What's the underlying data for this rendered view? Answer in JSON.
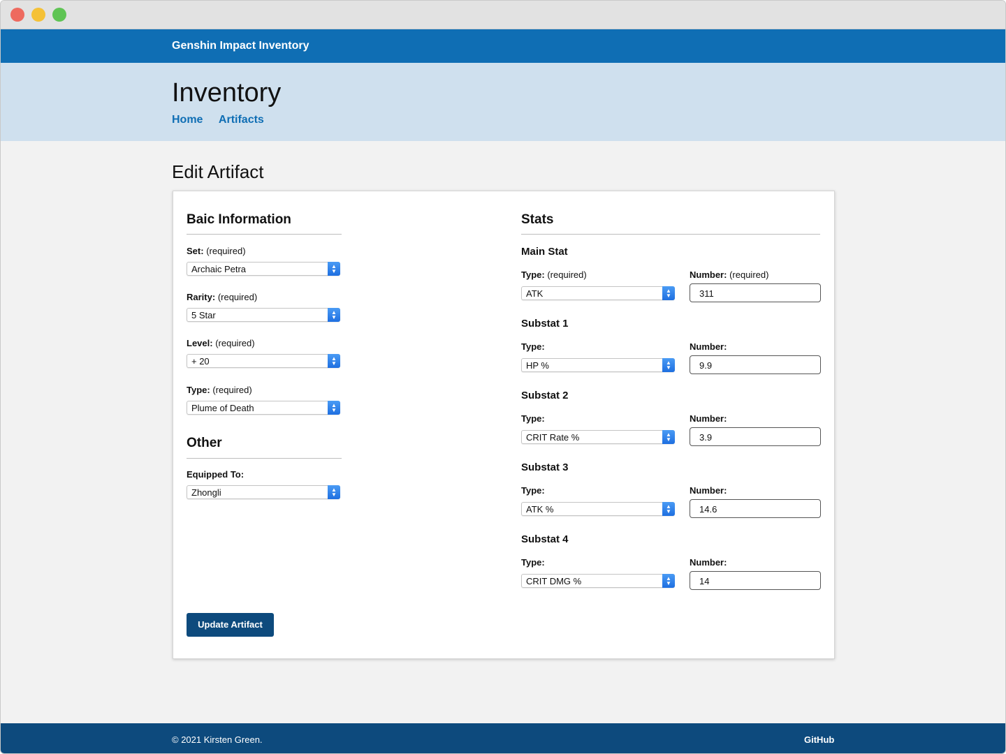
{
  "nav": {
    "brand": "Genshin Impact Inventory"
  },
  "hero": {
    "title": "Inventory",
    "links": [
      "Home",
      "Artifacts"
    ]
  },
  "page": {
    "heading": "Edit Artifact"
  },
  "basic": {
    "title": "Baic Information",
    "set": {
      "label": "Set:",
      "hint": "(required)",
      "value": "Archaic Petra"
    },
    "rarity": {
      "label": "Rarity:",
      "hint": "(required)",
      "value": "5 Star"
    },
    "level": {
      "label": "Level:",
      "hint": "(required)",
      "value": "+ 20"
    },
    "type": {
      "label": "Type:",
      "hint": "(required)",
      "value": "Plume of Death"
    }
  },
  "other": {
    "title": "Other",
    "equipped": {
      "label": "Equipped To:",
      "value": "Zhongli"
    }
  },
  "stats": {
    "title": "Stats",
    "main": {
      "title": "Main Stat",
      "type_label": "Type:",
      "type_hint": "(required)",
      "type_value": "ATK",
      "number_label": "Number:",
      "number_hint": "(required)",
      "number_value": "311"
    },
    "subs": [
      {
        "title": "Substat 1",
        "type_label": "Type:",
        "type_value": "HP %",
        "number_label": "Number:",
        "number_value": "9.9"
      },
      {
        "title": "Substat 2",
        "type_label": "Type:",
        "type_value": "CRIT Rate %",
        "number_label": "Number:",
        "number_value": "3.9"
      },
      {
        "title": "Substat 3",
        "type_label": "Type:",
        "type_value": "ATK %",
        "number_label": "Number:",
        "number_value": "14.6"
      },
      {
        "title": "Substat 4",
        "type_label": "Type:",
        "type_value": "CRIT DMG %",
        "number_label": "Number:",
        "number_value": "14"
      }
    ]
  },
  "actions": {
    "submit": "Update Artifact"
  },
  "footer": {
    "copyright": "© 2021 Kirsten Green.",
    "github": "GitHub"
  }
}
